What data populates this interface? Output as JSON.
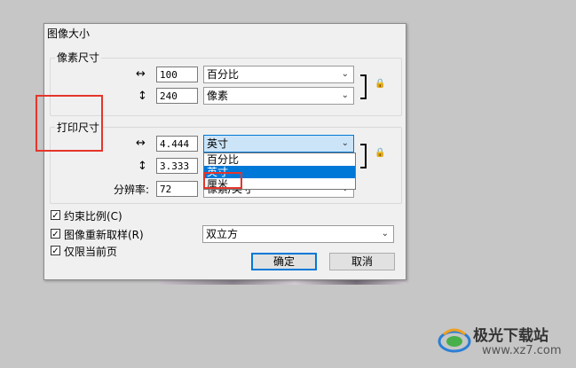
{
  "dialog": {
    "title": "图像大小",
    "pixel_section": {
      "label": "像素尺寸",
      "width_value": "100",
      "width_unit": "百分比",
      "height_value": "240",
      "height_unit": "像素"
    },
    "print_section": {
      "label": "打印尺寸",
      "width_value": "4.444",
      "width_unit": "英寸",
      "height_value": "3.333",
      "resolution_label": "分辨率:",
      "resolution_value": "72",
      "resolution_unit": "像素/英寸"
    },
    "unit_dropdown": {
      "options": [
        "百分比",
        "英寸",
        "厘米"
      ],
      "highlighted": "英寸"
    },
    "checkboxes": {
      "constrain": {
        "label": "约束比例(C)",
        "checked": true
      },
      "resample": {
        "label": "图像重新取样(R)",
        "checked": true
      },
      "current_page": {
        "label": "仅限当前页",
        "checked": true
      }
    },
    "resample_method": "双立方",
    "ok_label": "确定",
    "cancel_label": "取消"
  },
  "icons": {
    "horizontal": "↔",
    "vertical": "↕",
    "dropdown_arrow": "⌄",
    "check": "✓",
    "lock": "🔒"
  },
  "watermark": {
    "name": "极光下载站",
    "url": "www.xz7.com"
  },
  "colors": {
    "highlight": "#0078d7",
    "annotation_red": "#e5352b"
  }
}
